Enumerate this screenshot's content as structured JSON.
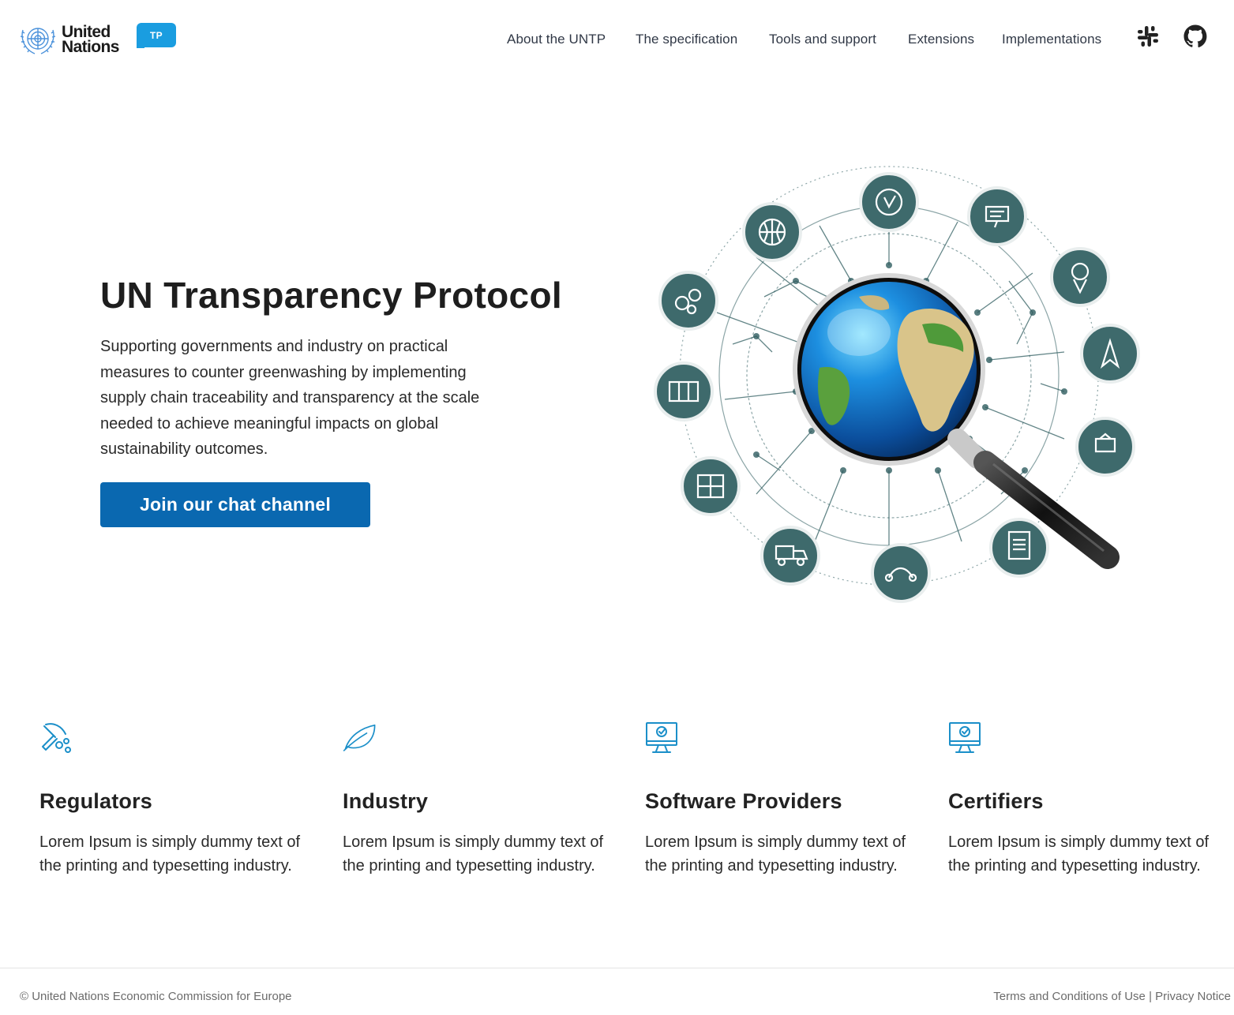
{
  "header": {
    "logo_line1": "United",
    "logo_line2": "Nations",
    "badge": "TP",
    "nav": [
      {
        "label": "About the UNTP"
      },
      {
        "label": "The specification"
      },
      {
        "label": "Tools and support"
      },
      {
        "label": "Extensions"
      },
      {
        "label": "Implementations"
      }
    ],
    "icons": [
      "slack-icon",
      "github-icon"
    ]
  },
  "hero": {
    "title": "UN Transparency Protocol",
    "text": "Supporting governments and industry on practical measures to counter greenwashing by implementing supply chain traceability and transparency at the scale needed to achieve meaningful impacts on global sustainability outcomes.",
    "cta": "Join our chat channel",
    "image_icon": "globe-magnifier-network-illustration"
  },
  "features": [
    {
      "title": "Regulators",
      "text": "Lorem Ipsum is simply dummy text of the printing and typesetting industry.",
      "icon": "pickaxe-icon"
    },
    {
      "title": "Industry",
      "text": "Lorem Ipsum is simply dummy text of the printing and typesetting industry.",
      "icon": "leaf-icon"
    },
    {
      "title": "Software Providers",
      "text": "Lorem Ipsum is simply dummy text of the printing and typesetting industry.",
      "icon": "monitor-check-icon"
    },
    {
      "title": "Certifiers",
      "text": "Lorem Ipsum is simply dummy text of the printing and typesetting industry.",
      "icon": "monitor-check-icon"
    }
  ],
  "footer": {
    "copyright": "© United Nations Economic Commission for Europe",
    "terms": "Terms and Conditions of Use",
    "separator": "|",
    "privacy": "Privacy Notice"
  },
  "colors": {
    "accent": "#0a68b0",
    "badge": "#1a9de0",
    "icon": "#1b8fc9",
    "teal": "#3b5e62"
  }
}
